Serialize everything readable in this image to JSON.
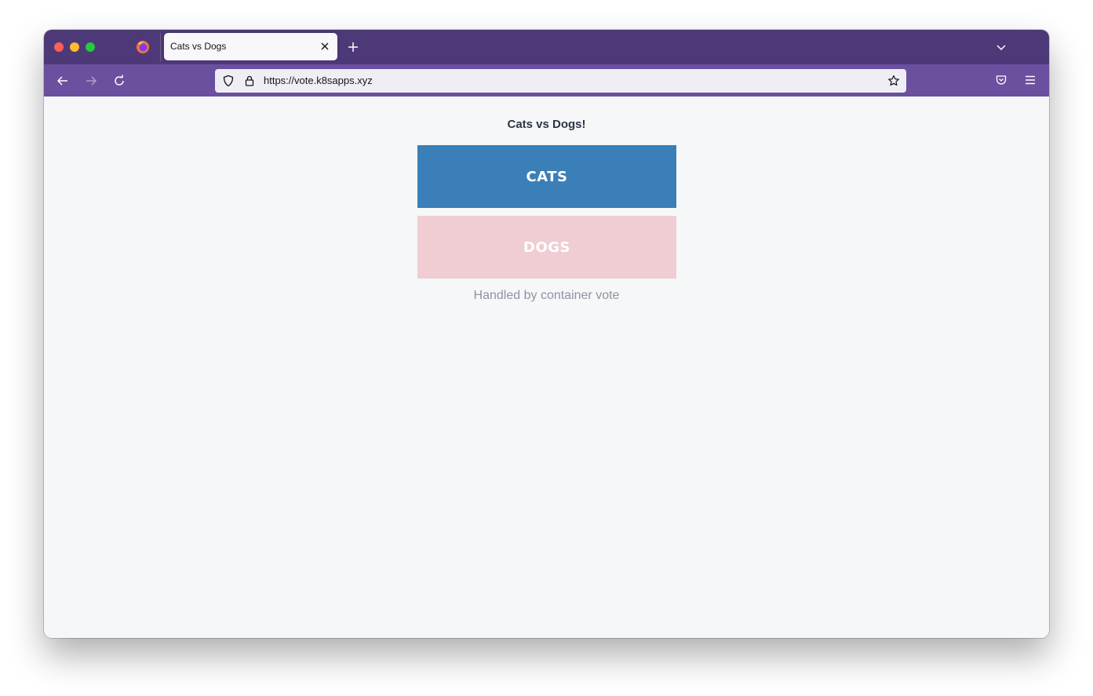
{
  "browser": {
    "tab": {
      "title": "Cats vs Dogs"
    },
    "url": "https://vote.k8sapps.xyz",
    "icons": {
      "tab_close": "close-icon",
      "new_tab": "plus-icon",
      "tab_list": "chevron-down-icon",
      "back": "arrow-left-icon",
      "forward": "arrow-right-icon",
      "reload": "reload-icon",
      "shield": "shield-icon",
      "lock": "lock-icon",
      "bookmark": "star-icon",
      "pocket": "pocket-icon",
      "menu": "hamburger-menu-icon",
      "app_logo": "firefox-logo-icon"
    },
    "colors": {
      "tabbar": "#4d3978",
      "navbar": "#6a509e",
      "urlbar": "#f0eef5"
    }
  },
  "page": {
    "title": "Cats vs Dogs!",
    "options": [
      {
        "label": "CATS",
        "color": "#3a7fb7"
      },
      {
        "label": "DOGS",
        "color": "#efcdd3"
      }
    ],
    "footer": "Handled by container vote",
    "background": "#f6f7f9"
  }
}
